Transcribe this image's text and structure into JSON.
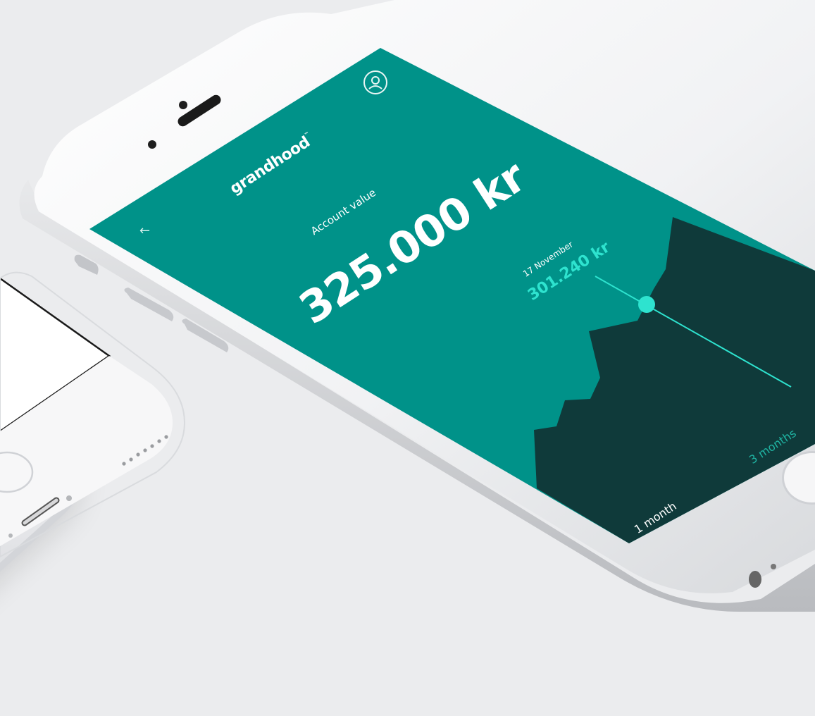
{
  "brand": {
    "logo_text": "grandhood",
    "trademark": "™"
  },
  "header": {
    "back_icon": "arrow-left-icon",
    "profile_icon": "user-circle-icon",
    "back_glyph": "←"
  },
  "account": {
    "label": "Account value",
    "value": "325.000 kr"
  },
  "tooltip": {
    "date": "17 November",
    "value": "301.240 kr"
  },
  "range_tabs": [
    {
      "label": "1 month",
      "selected": true
    },
    {
      "label": "3 months",
      "selected": false
    }
  ],
  "colors": {
    "screen_bg": "#009289",
    "chart_fill": "#0f3a3a",
    "accent": "#2ee3cf",
    "inactive_tab": "#1fb3a2"
  },
  "left_phone": {
    "badge_icon": "check-icon"
  }
}
